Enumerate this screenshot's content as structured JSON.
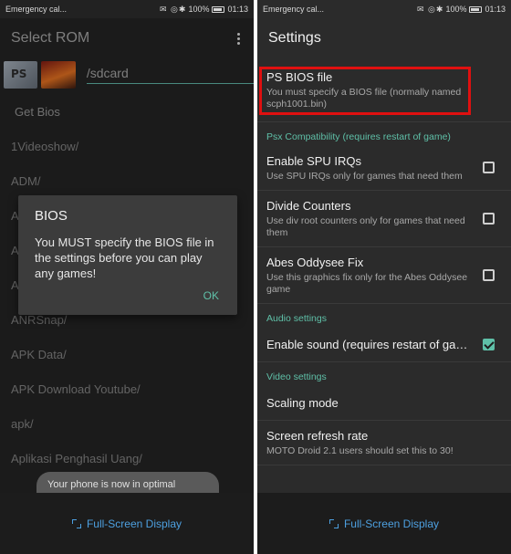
{
  "left": {
    "status": {
      "carrier": "Emergency cal...",
      "icons": "✉ ◎",
      "battery_pct": "100%",
      "time": "01:13"
    },
    "title": "Select ROM",
    "path": "/sdcard",
    "files": [
      "Get Bios",
      "1Videoshow/",
      "ADM/",
      "A",
      "A",
      "A",
      "ANRSnap/",
      "APK Data/",
      "APK Download Youtube/",
      "apk/",
      "Aplikasi Penghasil Uang/"
    ],
    "dialog": {
      "title": "BIOS",
      "message": "You MUST specify the BIOS file in the settings before you can play any games!",
      "ok": "OK"
    },
    "toast": "Your phone is now in optimal",
    "fullscreen": "Full-Screen Display"
  },
  "right": {
    "status": {
      "carrier": "Emergency cal...",
      "icons": "✉ ◎",
      "battery_pct": "100%",
      "time": "01:13"
    },
    "title": "Settings",
    "bios": {
      "title": "PS BIOS file",
      "summary": "You must specify a BIOS file (normally named scph1001.bin)"
    },
    "cat_compat": "Psx Compatibility (requires restart of game)",
    "spu": {
      "title": "Enable SPU IRQs",
      "summary": "Use SPU IRQs only for games that need them",
      "checked": false
    },
    "divide": {
      "title": "Divide Counters",
      "summary": "Use div root counters only for games that need them",
      "checked": false
    },
    "abes": {
      "title": "Abes Oddysee Fix",
      "summary": "Use this graphics fix only for the Abes Oddysee game",
      "checked": false
    },
    "cat_audio": "Audio settings",
    "sound": {
      "title": "Enable sound (requires restart of gam..",
      "checked": true
    },
    "cat_video": "Video settings",
    "scaling": {
      "title": "Scaling mode"
    },
    "refresh": {
      "title": "Screen refresh rate",
      "summary": "MOTO Droid 2.1 users should set this to 30!"
    },
    "fullscreen": "Full-Screen Display",
    "accent": "#5fc0a8",
    "highlight_color": "#e01010"
  }
}
